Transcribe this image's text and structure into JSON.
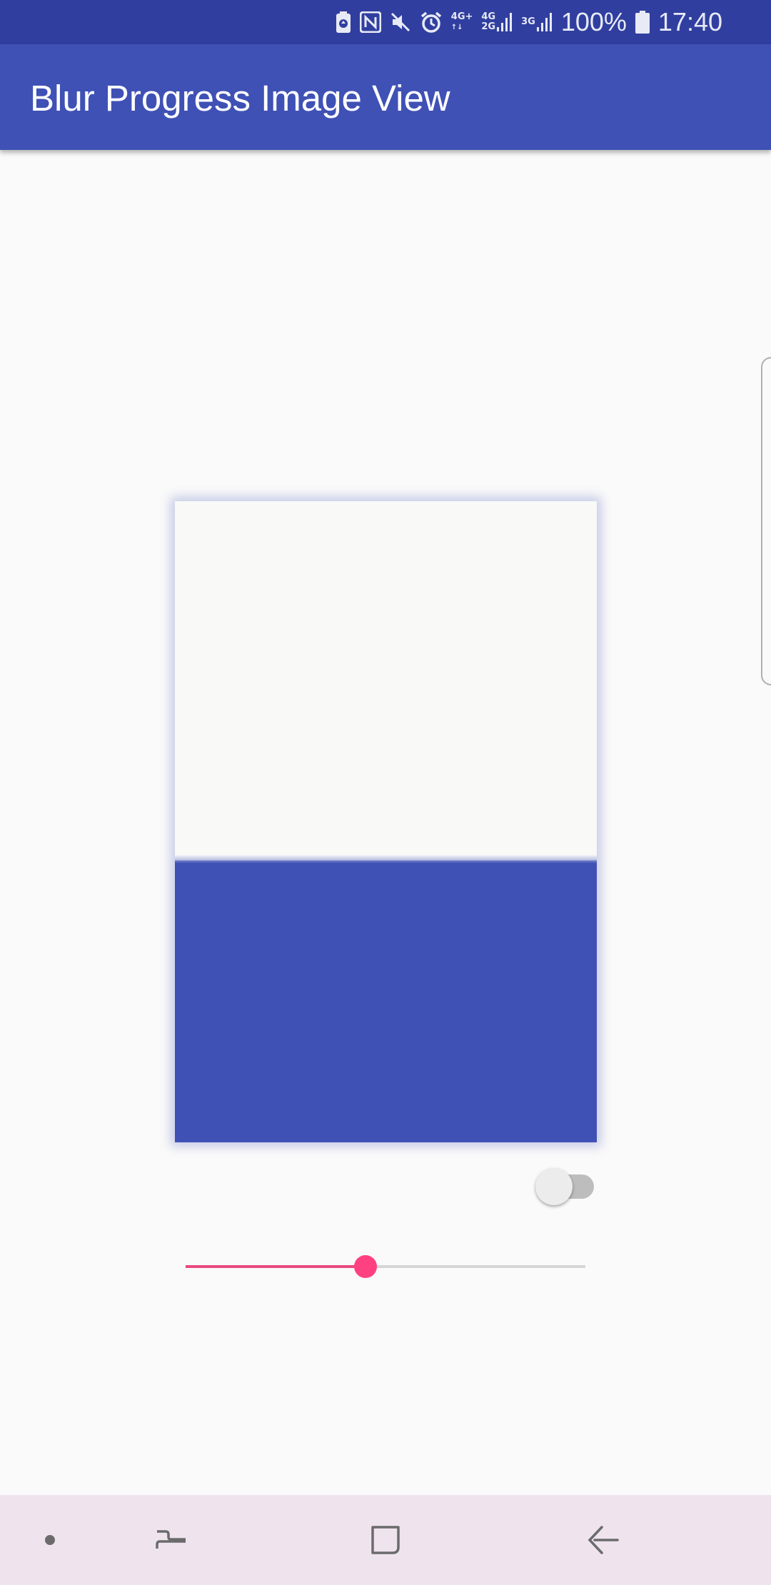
{
  "status_bar": {
    "network_4g_plus": "4G+",
    "network_4g_2g_top": "4G",
    "network_4g_2g_bottom": "2G",
    "network_3g": "3G",
    "battery_percent": "100%",
    "time": "17:40",
    "icons": [
      "battery-saver-icon",
      "nfc-icon",
      "mute-icon",
      "alarm-icon",
      "signal-4g-plus-icon",
      "signal-4g-2g-icon",
      "signal-3g-icon",
      "battery-icon"
    ]
  },
  "app_bar": {
    "title": "Blur Progress Image View"
  },
  "blur_image": {
    "progress": 0.44,
    "filled_color": "#3f51b5",
    "empty_color": "#f9f9f8"
  },
  "toggle": {
    "checked": false
  },
  "slider": {
    "value": 0.45,
    "accent_color": "#ff4081"
  },
  "nav_bar": {
    "buttons": [
      "dot-icon",
      "recent-apps-icon",
      "home-icon",
      "back-icon"
    ]
  },
  "colors": {
    "primary": "#3f51b5",
    "primary_dark": "#303f9f",
    "accent": "#ff4081",
    "background": "#fafafa"
  }
}
